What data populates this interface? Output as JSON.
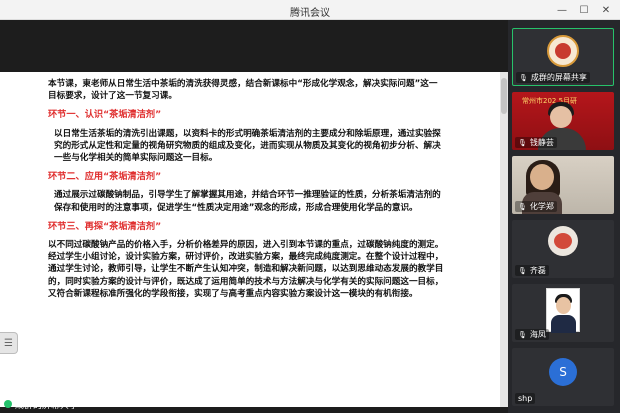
{
  "window": {
    "title": "腾讯会议"
  },
  "slide": {
    "intro": "本节课，東老师从日常生活中茶垢的清洗获得灵感，结合新课标中“形成化学观念，解决实际问题”这一目标要求，设计了这一节复习课。",
    "sections": [
      {
        "title": "环节一、认识“茶垢清洁剂”",
        "body": "以日常生活茶垢的清洗引出课题，以资料卡的形式明确茶垢清洁剂的主要成分和除垢原理，通过实验探究的形式从定性和定量的视角研究物质的组成及变化，进而实现从物质及其变化的视角初步分析、解决一些与化学相关的简单实际问题这一目标。"
      },
      {
        "title": "环节二、应用“茶垢清洁剂”",
        "body": "通过展示过碳酸钠制品，引导学生了解掌握其用途，并结合环节一推理验证的性质，分析茶垢清洁剂的保存和使用时的注意事项，促进学生“性质决定用途”观念的形成，形成合理使用化学品的意识。"
      },
      {
        "title": "环节三、再探“茶垢清洁剂”",
        "body": "以不同过碳酸钠产品的价格入手，分析价格差异的原因，进入引到本节课的重点，过碳酸钠纯度的测定。经过学生小组讨论，设计实验方案，研讨评价，改进实验方案，最终完成纯度测定。在整个设计过程中，通过学生讨论，教师引导，让学生不断产生认知冲突，制造和解决新问题，以达到思维动态发展的教学目的，同时实验方案的设计与评价，既达成了运用简单的技术与方法解决与化学有关的实际问题这一目标，又符合新课程标准所强化的学段衔接，实现了与高考重点内容实验方案设计这一模块的有机衔接。"
      }
    ]
  },
  "share_status": {
    "label": "成群的屏幕共享"
  },
  "participants": [
    {
      "name": "成群的屏幕共享",
      "kind": "logo"
    },
    {
      "name": "钱静芸",
      "kind": "banner",
      "banner_text": "常州市202 5月研"
    },
    {
      "name": "化学郑",
      "kind": "room"
    },
    {
      "name": "齐磊",
      "kind": "ball"
    },
    {
      "name": "海凤",
      "kind": "portrait"
    },
    {
      "name": "shp",
      "kind": "letter",
      "letter": "S"
    }
  ],
  "colors": {
    "section_title": "#e03030",
    "active_border": "#27c26a",
    "avatar_s": "#2b6fd6"
  },
  "icons": [
    "minimize-icon",
    "maximize-icon",
    "close-icon",
    "mic-icon",
    "side-toggle-icon"
  ]
}
